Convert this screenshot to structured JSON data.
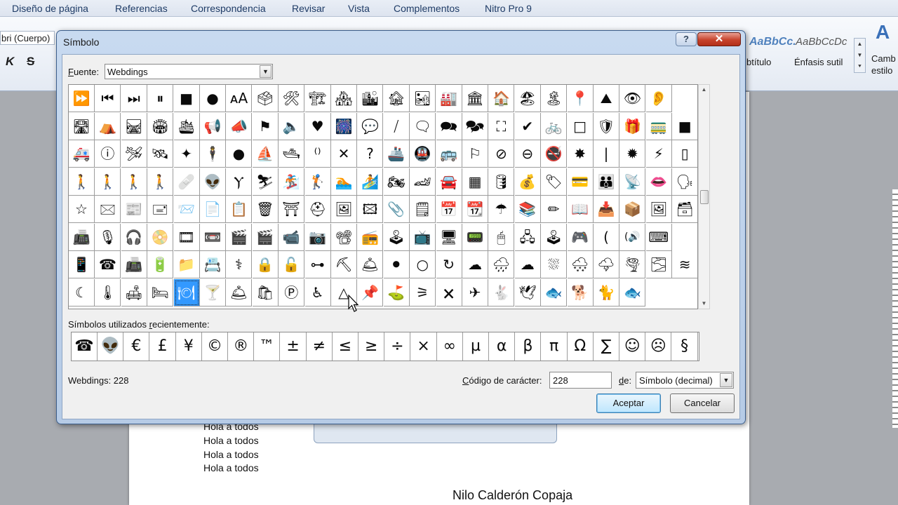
{
  "ribbon": {
    "tabs": [
      "Diseño de página",
      "Referencias",
      "Correspondencia",
      "Revisar",
      "Vista",
      "Complementos",
      "Nitro Pro 9"
    ],
    "font_name": "bri (Cuerpo)",
    "style_previews": [
      "AaBbCc.",
      "AaBbCcDc"
    ],
    "style_names": [
      "btítulo",
      "Énfasis sutil"
    ],
    "change_styles": [
      "Camb",
      "estilo"
    ]
  },
  "document": {
    "lines": [
      "Hola a todos",
      "Hola a todos",
      "Hola a todos",
      "Hola a todos"
    ],
    "author": "Nilo Calderón Copaja"
  },
  "dialog": {
    "title": "Símbolo",
    "help_label": "?",
    "close_label": "✕",
    "font_label_underlined": "F",
    "font_label_rest": "uente:",
    "font_value": "Webdings",
    "recent_label_pre": "Símbolos utilizados ",
    "recent_label_underlined": "r",
    "recent_label_post": "ecientemente:",
    "status_text": "Webdings: 228",
    "code_label_underlined": "C",
    "code_label_rest": "ódigo de carácter:",
    "code_value": "228",
    "de_label_underlined": "d",
    "de_label_rest": "e:",
    "de_value": "Símbolo (decimal)",
    "ok_label": "Aceptar",
    "cancel_label": "Cancelar",
    "selected_cell": [
      7,
      4
    ],
    "grid": [
      [
        "⏩",
        "⏮",
        "⏭",
        "⏸",
        "■",
        "●",
        "ᴀA",
        "🗳",
        "🛠",
        "🏗",
        "🏘",
        "🏙",
        "🏚",
        "🏜",
        "🏭",
        "🏛",
        "🏠",
        "🏖",
        "🏝",
        "📍",
        "⛰",
        "👁",
        "👂"
      ],
      [
        "🛣",
        "⛺",
        "🛤",
        "🏟",
        "🛳",
        "📢",
        "📣",
        "⚑",
        "🔈",
        "♥",
        "🎆",
        "💬",
        "⧸",
        "🗨",
        "🗪",
        "🗫",
        "⛶",
        "✔",
        "🚲",
        "□",
        "🛡",
        "🎁",
        "🚃",
        "■"
      ],
      [
        "🚑",
        "ⓘ",
        "🛩",
        "🛰",
        "✦",
        "🕴",
        "●",
        "⛵",
        "🛥",
        "⁽⁾",
        "✕",
        "?",
        "🚢",
        "🚇",
        "🚌",
        "⚐",
        "⊘",
        "⊖",
        "🚭",
        "✸",
        "|",
        "✹",
        "⚡",
        "▯"
      ],
      [
        "🚶",
        "🚶",
        "🚶",
        "🚶",
        "🩹",
        "👽",
        "Ⲩ",
        "⛷",
        "🏂",
        "🏌",
        "🏊",
        "🏄",
        "🏍",
        "🏎",
        "🚘",
        "▦",
        "🛢",
        "💰",
        "🏷",
        "💳",
        "👪",
        "📡",
        "👄",
        "🗣"
      ],
      [
        "☆",
        "🖂",
        "📰",
        "🖃",
        "📨",
        "📄",
        "📋",
        "🗑",
        "⛩",
        "⛑",
        "🖼",
        "🖾",
        "📎",
        "🗒",
        "📅",
        "📆",
        "☂",
        "📚",
        "✏",
        "📖",
        "📥",
        "📦",
        "🖼",
        "🗃",
        "♫"
      ],
      [
        "📠",
        "🎙",
        "🎧",
        "📀",
        "🎞",
        "📼",
        "🎬",
        "🎬",
        "📹",
        "📷",
        "📽",
        "📻",
        "🕹",
        "📺",
        "🖥",
        "📟",
        "🖱",
        "🖧",
        "🕹",
        "🎮",
        "(",
        "(🔊",
        "⌨"
      ],
      [
        "📱",
        "☎",
        "📠",
        "🔋",
        "📁",
        "📇",
        "⚕",
        "🔒",
        "🔓",
        "⊶",
        "⛏",
        "🛎",
        "⚫",
        "○",
        "↻",
        "☁",
        "🌧",
        "☁",
        "⛆",
        "🌨",
        "🌩",
        "🌪",
        "🌫",
        "≋"
      ],
      [
        "☾",
        "🌡",
        "🛋",
        "🛏",
        "🍽",
        "🍸",
        "🛎",
        "🛍",
        "Ⓟ",
        "♿",
        "△",
        "📌",
        "⛳",
        "⚞",
        "🗙",
        "✈",
        "🐇",
        "🕊",
        "🐟",
        "🐕",
        "🐈",
        "🐟"
      ]
    ],
    "recent": [
      "☎",
      "👽",
      "€",
      "£",
      "¥",
      "©",
      "®",
      "™",
      "±",
      "≠",
      "≤",
      "≥",
      "÷",
      "×",
      "∞",
      "µ",
      "α",
      "β",
      "π",
      "Ω",
      "∑",
      "☺",
      "☹",
      "§"
    ]
  }
}
